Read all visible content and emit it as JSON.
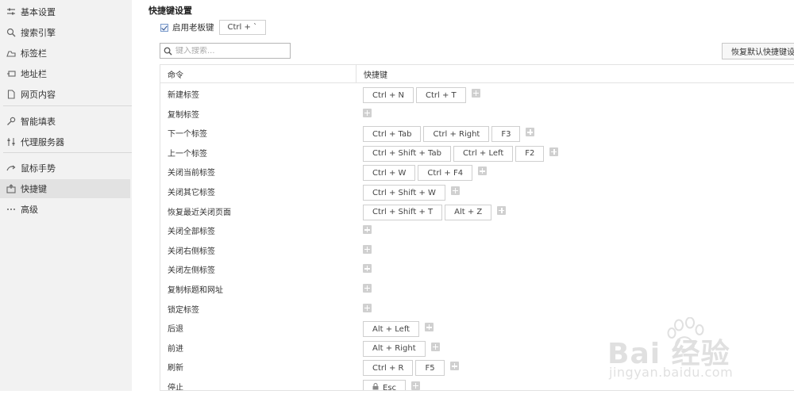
{
  "sidebar": {
    "items": [
      {
        "label": "基本设置",
        "icon": "sliders-icon"
      },
      {
        "label": "搜索引擎",
        "icon": "search-icon"
      },
      {
        "label": "标签栏",
        "icon": "tabs-icon"
      },
      {
        "label": "地址栏",
        "icon": "address-bar-icon"
      },
      {
        "label": "网页内容",
        "icon": "page-icon"
      },
      {
        "label": "智能填表",
        "icon": "key-icon"
      },
      {
        "label": "代理服务器",
        "icon": "proxy-icon"
      },
      {
        "label": "鼠标手势",
        "icon": "gesture-icon"
      },
      {
        "label": "快捷键",
        "icon": "shortcut-icon",
        "active": true
      },
      {
        "label": "高级",
        "icon": "more-icon"
      }
    ]
  },
  "main": {
    "section_title": "快捷键设置",
    "enable_boss_key": {
      "label": "启用老板键",
      "checked": true,
      "value": "Ctrl + `"
    },
    "search": {
      "placeholder": "键入搜索..."
    },
    "restore_button": "恢复默认快捷键设置",
    "table": {
      "headers": {
        "command": "命令",
        "shortcut": "快捷键"
      },
      "rows": [
        {
          "command": "新建标签",
          "keys": [
            "Ctrl + N",
            "Ctrl + T"
          ]
        },
        {
          "command": "复制标签",
          "keys": []
        },
        {
          "command": "下一个标签",
          "keys": [
            "Ctrl + Tab",
            "Ctrl + Right",
            "F3"
          ]
        },
        {
          "command": "上一个标签",
          "keys": [
            "Ctrl + Shift + Tab",
            "Ctrl + Left",
            "F2"
          ]
        },
        {
          "command": "关闭当前标签",
          "keys": [
            "Ctrl + W",
            "Ctrl + F4"
          ]
        },
        {
          "command": "关闭其它标签",
          "keys": [
            "Ctrl + Shift + W"
          ]
        },
        {
          "command": "恢复最近关闭页面",
          "keys": [
            "Ctrl + Shift + T",
            "Alt + Z"
          ]
        },
        {
          "command": "关闭全部标签",
          "keys": []
        },
        {
          "command": "关闭右侧标签",
          "keys": []
        },
        {
          "command": "关闭左侧标签",
          "keys": []
        },
        {
          "command": "复制标题和网址",
          "keys": []
        },
        {
          "command": "锁定标签",
          "keys": []
        },
        {
          "command": "后退",
          "keys": [
            "Alt + Left"
          ]
        },
        {
          "command": "前进",
          "keys": [
            "Alt + Right"
          ]
        },
        {
          "command": "刷新",
          "keys": [
            "Ctrl + R",
            "F5"
          ]
        },
        {
          "command": "停止",
          "keys": [
            "Esc"
          ],
          "locked": true
        }
      ]
    }
  },
  "watermark": {
    "main": "Bai 经验",
    "sub": "jingyan.baidu.com"
  }
}
